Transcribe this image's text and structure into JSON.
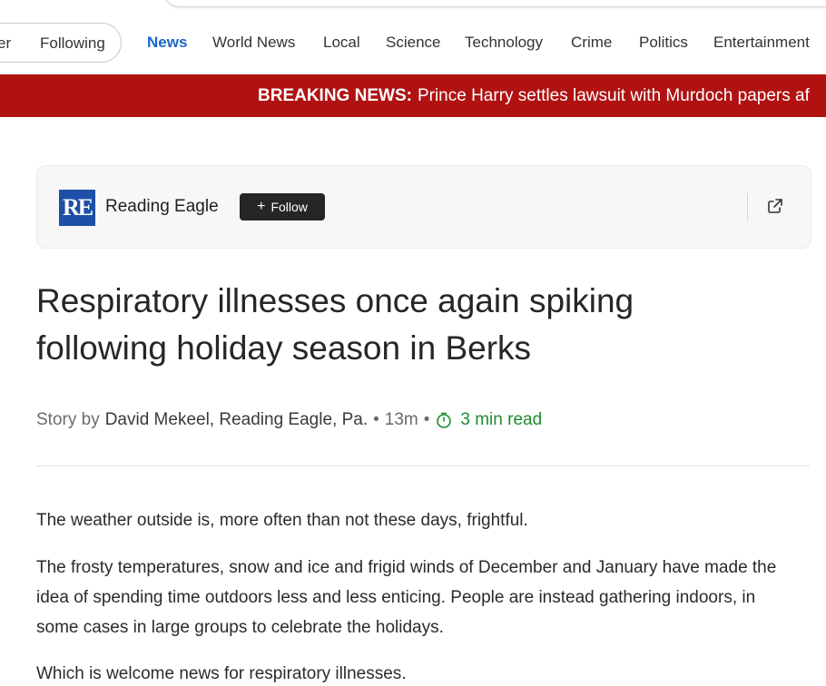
{
  "nav": {
    "prev_partial": "er",
    "following": "Following",
    "items": [
      "News",
      "World News",
      "Local",
      "Science",
      "Technology",
      "Crime",
      "Politics",
      "Entertainment"
    ],
    "active": "News"
  },
  "breaking": {
    "label": "BREAKING NEWS:",
    "text": "Prince Harry settles lawsuit with Murdoch papers af"
  },
  "publisher": {
    "logo_text": "RE",
    "name": "Reading Eagle",
    "follow_label": "Follow",
    "share_icon": "share-icon"
  },
  "article": {
    "headline": "Respiratory illnesses once again spiking following holiday season in Berks",
    "byline_prefix": "Story by",
    "author": "David Mekeel, Reading Eagle, Pa.",
    "age": "13m",
    "read_time": "3 min read",
    "paragraphs": [
      "The weather outside is, more often than not these days, frightful.",
      "The frosty temperatures, snow and ice and frigid winds of December and January have made the idea of spending time outdoors less and less enticing. People are instead gathering indoors, in some cases in large groups to celebrate the holidays.",
      "Which is welcome news for respiratory illnesses."
    ]
  },
  "colors": {
    "accent": "#1a66c8",
    "breaking_bg": "#b01212",
    "read_time": "#1f8a2e"
  }
}
